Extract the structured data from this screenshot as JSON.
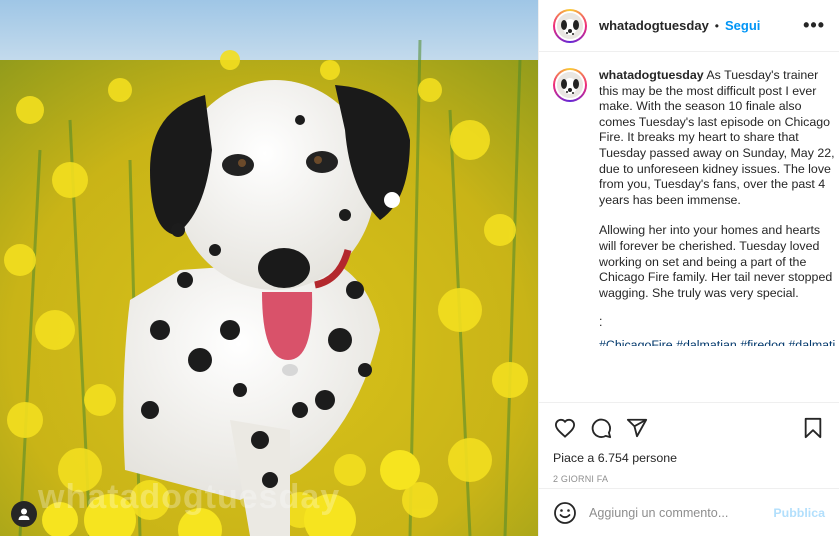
{
  "photo": {
    "watermark": "whatadogtuesday",
    "tag_icon": "user-silhouette-icon"
  },
  "header": {
    "username": "whatadogtuesday",
    "separator": "•",
    "follow_label": "Segui",
    "more_icon": "more-horizontal-icon",
    "more_label": "•••"
  },
  "caption": {
    "username": "whatadogtuesday",
    "paragraph1": "As Tuesday's trainer this may be the most difficult post I ever make. With the season 10 finale also comes Tuesday's last episode on Chicago Fire.  It breaks my heart to share that Tuesday passed away on Sunday, May 22, due to unforeseen kidney issues.  The love from you, Tuesday's fans, over the past 4 years has been immense.",
    "paragraph2": "Allowing her into your homes and hearts will forever be cherished.  Tuesday loved working on set and being a part of the Chicago Fire family.   Her tail never stopped wagging. She truly was very special.",
    "dot1": ".",
    "dot2": ".",
    "hashtags": "#ChicagoFire #dalmatian #firedog #dalmatiansofinstagram"
  },
  "actions": {
    "like_icon": "heart-icon",
    "comment_icon": "comment-icon",
    "share_icon": "paper-plane-icon",
    "save_icon": "bookmark-icon",
    "likes_text": "Piace a 6.754 persone",
    "date_text": "2 GIORNI FA"
  },
  "comment_bar": {
    "emoji_icon": "smiley-icon",
    "placeholder": "Aggiungi un commento...",
    "publish_label": "Pubblica"
  },
  "colors": {
    "accent_blue": "#0095f6",
    "publish_disabled": "#b2dffc",
    "hashtag": "#00376b",
    "text": "#262626",
    "muted": "#8e8e8e"
  }
}
